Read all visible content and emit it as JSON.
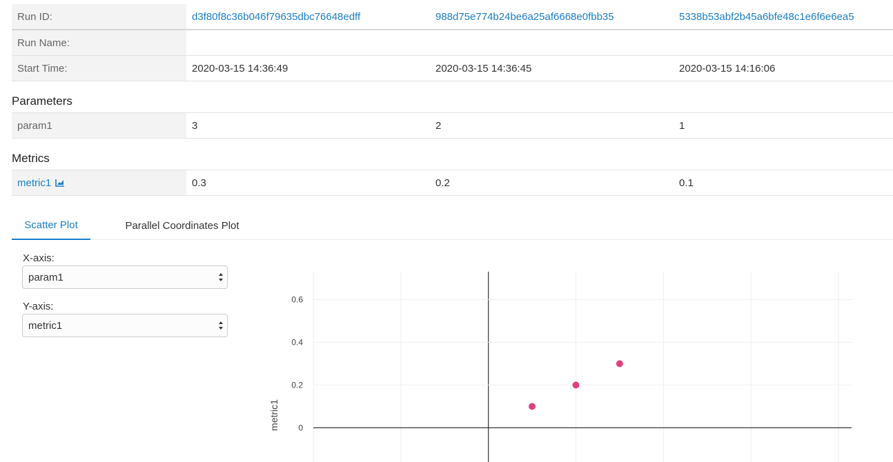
{
  "table": {
    "run_id_label": "Run ID:",
    "run_ids": [
      "d3f80f8c36b046f79635dbc76648edff",
      "988d75e774b24be6a25af6668e0fbb35",
      "5338b53abf2b45a6bfe48c1e6f6e6ea5"
    ],
    "run_name_label": "Run Name:",
    "run_names": [
      "",
      "",
      ""
    ],
    "start_time_label": "Start Time:",
    "start_times": [
      "2020-03-15 14:36:49",
      "2020-03-15 14:36:45",
      "2020-03-15 14:16:06"
    ]
  },
  "parameters": {
    "title": "Parameters",
    "name": "param1",
    "values": [
      "3",
      "2",
      "1"
    ]
  },
  "metrics": {
    "title": "Metrics",
    "name": "metric1",
    "icon": "line-chart-icon",
    "values": [
      "0.3",
      "0.2",
      "0.1"
    ]
  },
  "tabs": {
    "scatter": "Scatter Plot",
    "parallel": "Parallel Coordinates Plot",
    "active": "scatter"
  },
  "controls": {
    "x_label": "X-axis:",
    "x_value": "param1",
    "y_label": "Y-axis:",
    "y_value": "metric1"
  },
  "colors": {
    "accent": "#1a7ec8",
    "point": "#e0407f"
  },
  "chart_data": {
    "type": "scatter",
    "x": [
      1,
      2,
      3
    ],
    "y": [
      0.1,
      0.2,
      0.3
    ],
    "xlabel": "",
    "ylabel": "metric1",
    "ylim": [
      -0.16,
      0.73
    ],
    "xlim": [
      -4,
      8.3
    ],
    "y_ticks": [
      0,
      0.2,
      0.4,
      0.6
    ],
    "y_tick_labels": [
      "0",
      "0.2",
      "0.4",
      "0.6"
    ],
    "x_grid": [
      -4,
      -2,
      0,
      2,
      4,
      6,
      8
    ],
    "grid": true
  }
}
